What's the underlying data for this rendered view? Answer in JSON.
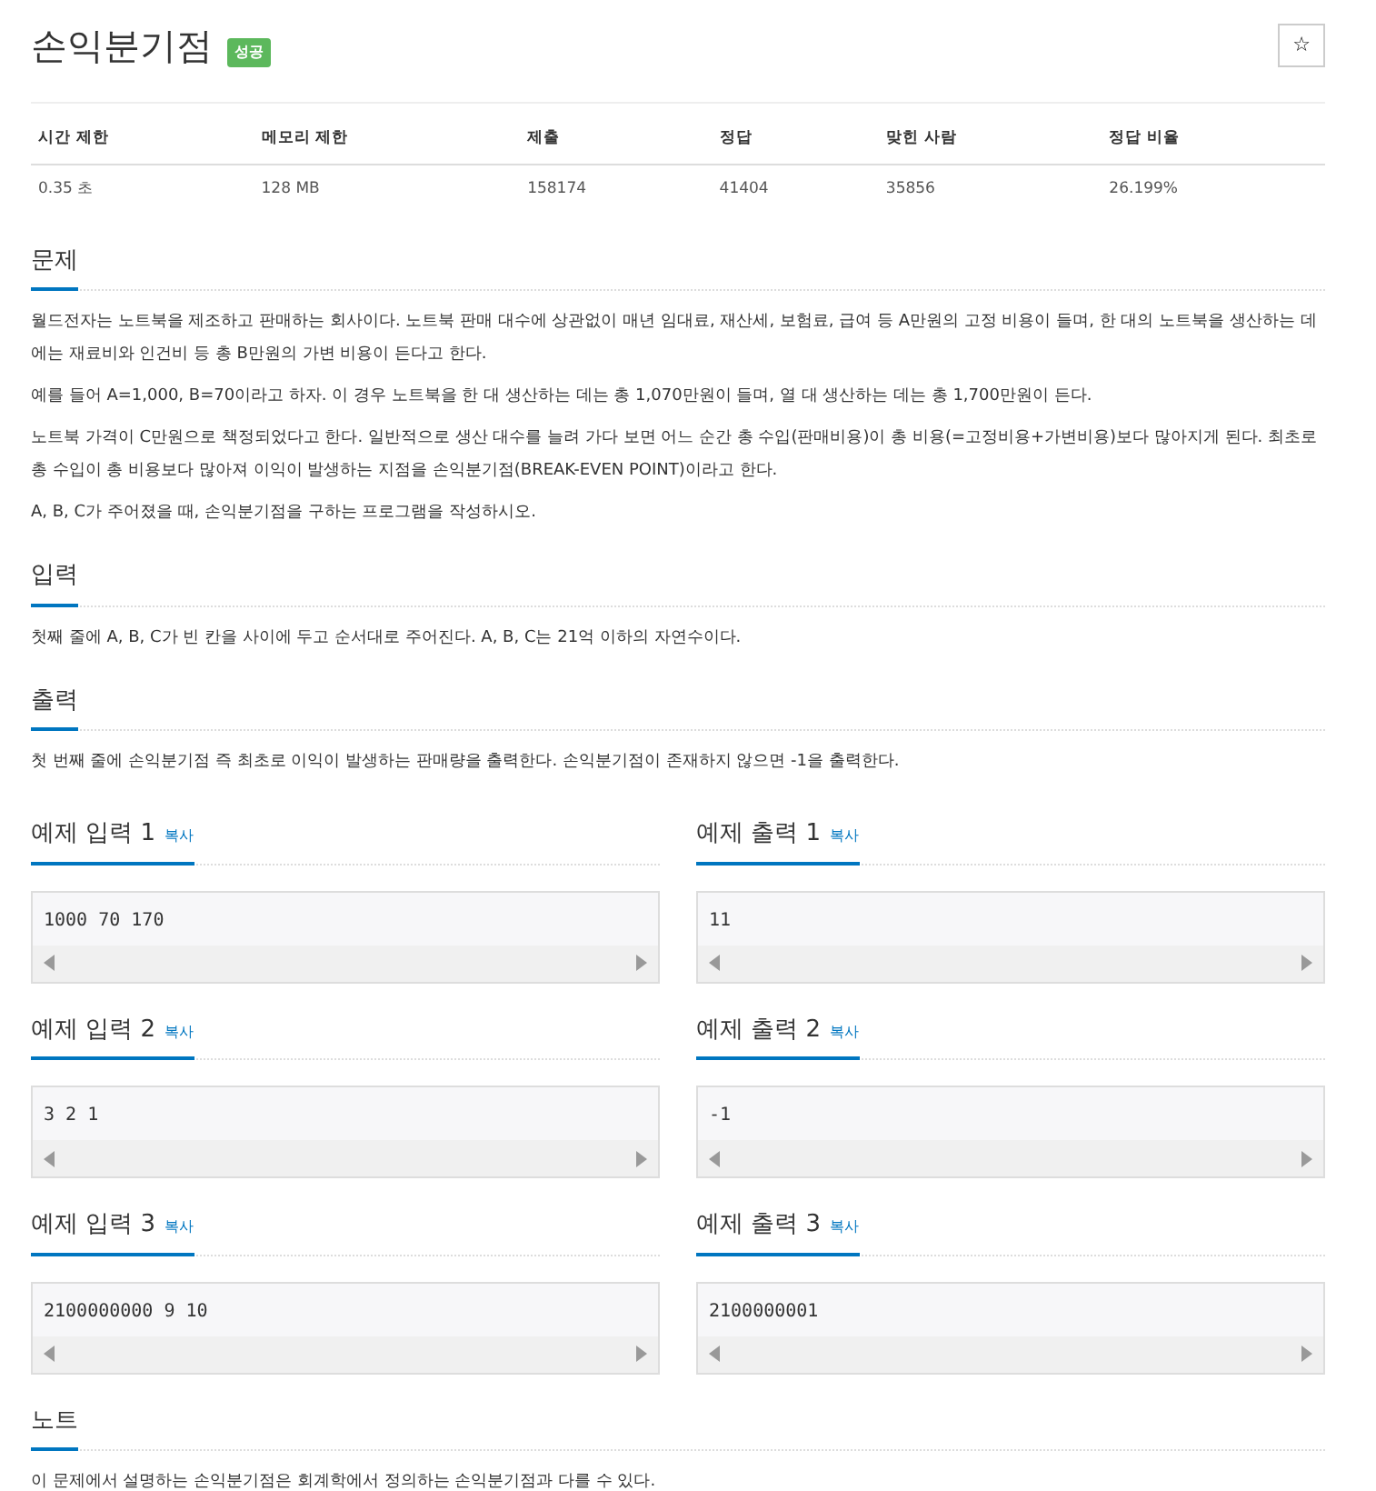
{
  "title": "손익분기점",
  "badge": "성공",
  "star_button": "☆",
  "stats": {
    "columns": [
      "시간 제한",
      "메모리 제한",
      "제출",
      "정답",
      "맞힌 사람",
      "정답 비율"
    ],
    "row": [
      "0.35 초",
      "128 MB",
      "158174",
      "41404",
      "35856",
      "26.199%"
    ]
  },
  "sections": [
    {
      "kind": "text",
      "heading": "문제",
      "paragraphs": [
        "월드전자는 노트북을 제조하고 판매하는 회사이다. 노트북 판매 대수에 상관없이 매년 임대료, 재산세, 보험료, 급여 등 A만원의 고정 비용이 들며, 한 대의 노트북을 생산하는 데에는 재료비와 인건비 등 총 B만원의 가변 비용이 든다고 한다.",
        "예를 들어 A=1,000, B=70이라고 하자. 이 경우 노트북을 한 대 생산하는 데는 총 1,070만원이 들며, 열 대 생산하는 데는 총 1,700만원이 든다.",
        "노트북 가격이 C만원으로 책정되었다고 한다. 일반적으로 생산 대수를 늘려 가다 보면 어느 순간 총 수입(판매비용)이 총 비용(=고정비용+가변비용)보다 많아지게 된다. 최초로 총 수입이 총 비용보다 많아져 이익이 발생하는 지점을 손익분기점(BREAK-EVEN POINT)이라고 한다.",
        "A, B, C가 주어졌을 때, 손익분기점을 구하는 프로그램을 작성하시오."
      ]
    },
    {
      "kind": "text",
      "heading": "입력",
      "paragraphs": [
        "첫째 줄에 A, B, C가 빈 칸을 사이에 두고 순서대로 주어진다. A, B, C는 21억 이하의 자연수이다."
      ]
    },
    {
      "kind": "text",
      "heading": "출력",
      "paragraphs": [
        "첫 번째 줄에 손익분기점 즉 최초로 이익이 발생하는 판매량을 출력한다. 손익분기점이 존재하지 않으면 -1을 출력한다."
      ]
    },
    {
      "kind": "samples",
      "pairs": [
        {
          "input_heading": "예제 입력 1",
          "input_copy": "복사",
          "input": "1000 70 170",
          "output_heading": "예제 출력 1",
          "output_copy": "복사",
          "output": "11"
        },
        {
          "input_heading": "예제 입력 2",
          "input_copy": "복사",
          "input": "3 2 1",
          "output_heading": "예제 출력 2",
          "output_copy": "복사",
          "output": "-1"
        },
        {
          "input_heading": "예제 입력 3",
          "input_copy": "복사",
          "input": "2100000000 9 10",
          "output_heading": "예제 출력 3",
          "output_copy": "복사",
          "output": "2100000001"
        }
      ]
    },
    {
      "kind": "text",
      "heading": "노트",
      "paragraphs": [
        "이 문제에서 설명하는 손익분기점은 회계학에서 정의하는 손익분기점과 다를 수 있다."
      ]
    }
  ]
}
